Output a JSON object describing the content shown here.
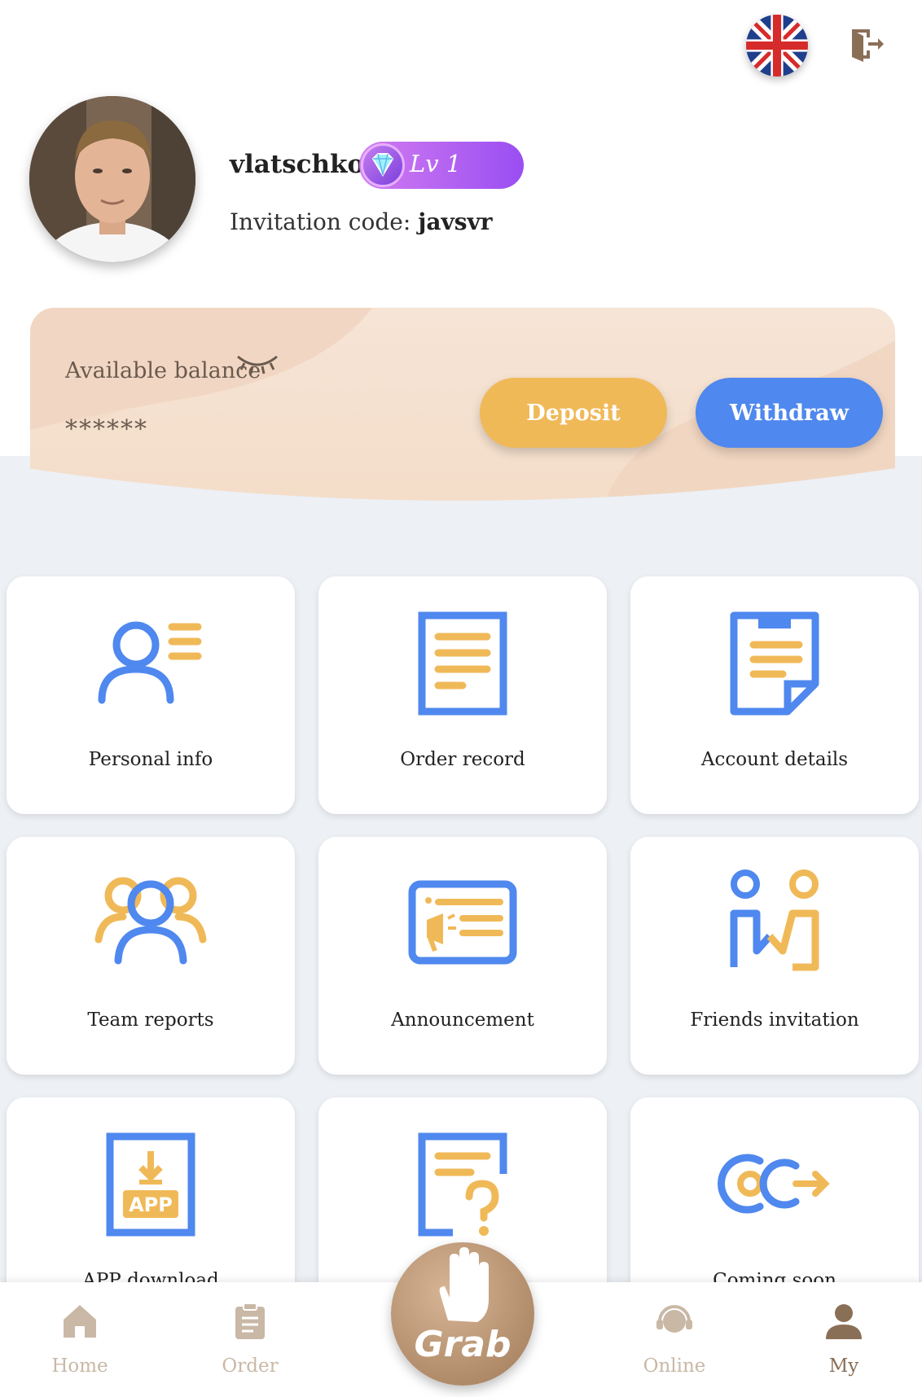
{
  "header": {
    "language_icon": "uk-flag-icon",
    "logout_icon": "logout-icon"
  },
  "profile": {
    "username": "vlatschko",
    "level": "Lv 1",
    "invitation_label": "Invitation code:",
    "invitation_code": "javsvr"
  },
  "balance": {
    "label": "Available balance",
    "value": "******",
    "deposit_label": "Deposit",
    "withdraw_label": "Withdraw"
  },
  "menu": [
    {
      "label": "Personal info",
      "icon": "personal-info-icon"
    },
    {
      "label": "Order record",
      "icon": "order-record-icon"
    },
    {
      "label": "Account details",
      "icon": "account-details-icon"
    },
    {
      "label": "Team reports",
      "icon": "team-reports-icon"
    },
    {
      "label": "Announcement",
      "icon": "announcement-icon"
    },
    {
      "label": "Friends invitation",
      "icon": "friends-invitation-icon"
    },
    {
      "label": "APP download",
      "icon": "app-download-icon"
    },
    {
      "label": "",
      "icon": "help-icon"
    },
    {
      "label": "Coming soon",
      "icon": "coming-soon-icon"
    }
  ],
  "nav": {
    "home": "Home",
    "order": "Order",
    "grab": "Grab",
    "online": "Online",
    "my": "My"
  },
  "colors": {
    "blue": "#4f88ee",
    "orange": "#f0b958",
    "nav_inactive": "#c9b8a6",
    "nav_active": "#8a6f57"
  }
}
